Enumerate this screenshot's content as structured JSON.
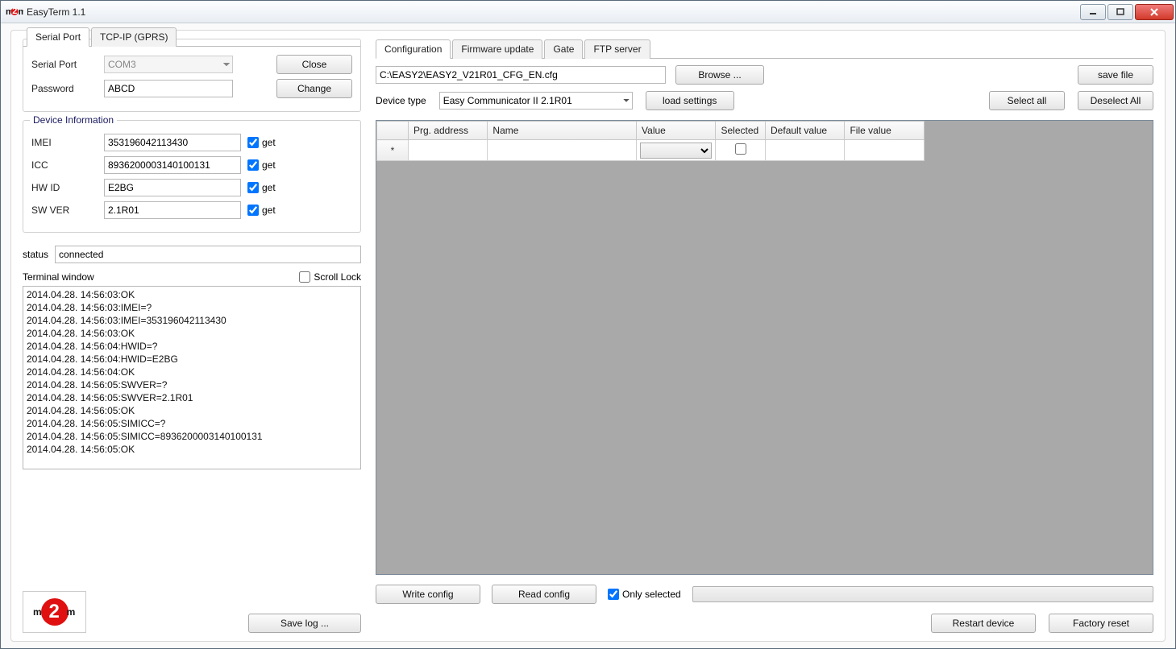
{
  "window": {
    "title": "EasyTerm 1.1"
  },
  "leftTabs": {
    "serial": "Serial Port",
    "tcp": "TCP-IP (GPRS)"
  },
  "serial": {
    "portLabel": "Serial Port",
    "portValue": "COM3",
    "passwordLabel": "Password",
    "passwordValue": "ABCD",
    "closeBtn": "Close",
    "changeBtn": "Change"
  },
  "devInfo": {
    "title": "Device Information",
    "imeiLabel": "IMEI",
    "imeiValue": "353196042113430",
    "iccLabel": "ICC",
    "iccValue": "8936200003140100131",
    "hwLabel": "HW ID",
    "hwValue": "E2BG",
    "swLabel": "SW VER",
    "swValue": "2.1R01",
    "getLabel": "get"
  },
  "status": {
    "label": "status",
    "value": "connected"
  },
  "terminal": {
    "title": "Terminal window",
    "scrollLock": "Scroll Lock",
    "lines": [
      "2014.04.28. 14:56:03:OK",
      "2014.04.28. 14:56:03:IMEI=?",
      "2014.04.28. 14:56:03:IMEI=353196042113430",
      "2014.04.28. 14:56:03:OK",
      "2014.04.28. 14:56:04:HWID=?",
      "2014.04.28. 14:56:04:HWID=E2BG",
      "2014.04.28. 14:56:04:OK",
      "2014.04.28. 14:56:05:SWVER=?",
      "2014.04.28. 14:56:05:SWVER=2.1R01",
      "2014.04.28. 14:56:05:OK",
      "2014.04.28. 14:56:05:SIMICC=?",
      "2014.04.28. 14:56:05:SIMICC=8936200003140100131",
      "2014.04.28. 14:56:05:OK"
    ],
    "saveLog": "Save log ..."
  },
  "rightTabs": {
    "config": "Configuration",
    "firmware": "Firmware update",
    "gate": "Gate",
    "ftp": "FTP server"
  },
  "config": {
    "path": "C:\\EASY2\\EASY2_V21R01_CFG_EN.cfg",
    "browseBtn": "Browse ...",
    "saveFileBtn": "save file",
    "deviceTypeLabel": "Device type",
    "deviceTypeValue": "Easy Communicator II 2.1R01",
    "loadSettingsBtn": "load settings",
    "selectAllBtn": "Select all",
    "deselectAllBtn": "Deselect All"
  },
  "grid": {
    "headers": {
      "prg": "Prg. address",
      "name": "Name",
      "value": "Value",
      "selected": "Selected",
      "default": "Default value",
      "file": "File value"
    },
    "newRowMarker": "*"
  },
  "bottom": {
    "writeConfig": "Write config",
    "readConfig": "Read config",
    "onlySelected": "Only selected",
    "restart": "Restart device",
    "factory": "Factory reset"
  },
  "logo": {
    "text1": "m",
    "text2": "2",
    "text3": "m"
  }
}
